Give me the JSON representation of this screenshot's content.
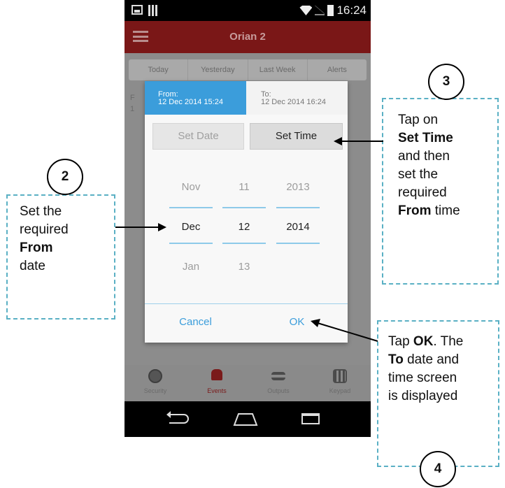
{
  "status_bar": {
    "time": "16:24"
  },
  "app": {
    "title": "Orian 2"
  },
  "tabs": [
    "Today",
    "Yesterday",
    "Last Week",
    "Alerts"
  ],
  "background": {
    "row_letter": "F",
    "row_digit": "1"
  },
  "dialog": {
    "from_label": "From:",
    "from_value": "12 Dec 2014  15:24",
    "to_label": "To:",
    "to_value": "12 Dec 2014  16:24",
    "set_date": "Set Date",
    "set_time": "Set Time",
    "picker": {
      "months": [
        "Nov",
        "Dec",
        "Jan"
      ],
      "days": [
        "11",
        "12",
        "13"
      ],
      "years": [
        "2013",
        "2014",
        ""
      ]
    },
    "cancel": "Cancel",
    "ok": "OK"
  },
  "bottom_nav": [
    {
      "label": "Security",
      "icon": "shield-icon"
    },
    {
      "label": "Events",
      "icon": "alarm-icon"
    },
    {
      "label": "Outputs",
      "icon": "toggles-icon"
    },
    {
      "label": "Keypad",
      "icon": "keypad-icon"
    }
  ],
  "callouts": {
    "c2": {
      "number": "2",
      "lines": [
        "Set the",
        "required",
        "From",
        "date"
      ]
    },
    "c3": {
      "number": "3",
      "lines": [
        "Tap on",
        "Set Time",
        "and then",
        "set the",
        "required",
        "From time"
      ]
    },
    "c4": {
      "number": "4",
      "lines": [
        "Tap OK. The",
        "To date and",
        "time screen",
        "is displayed"
      ]
    }
  },
  "colors": {
    "app_bar": "#7a1717",
    "accent": "#3b9ddb",
    "callout_border": "#5ab0c4"
  }
}
